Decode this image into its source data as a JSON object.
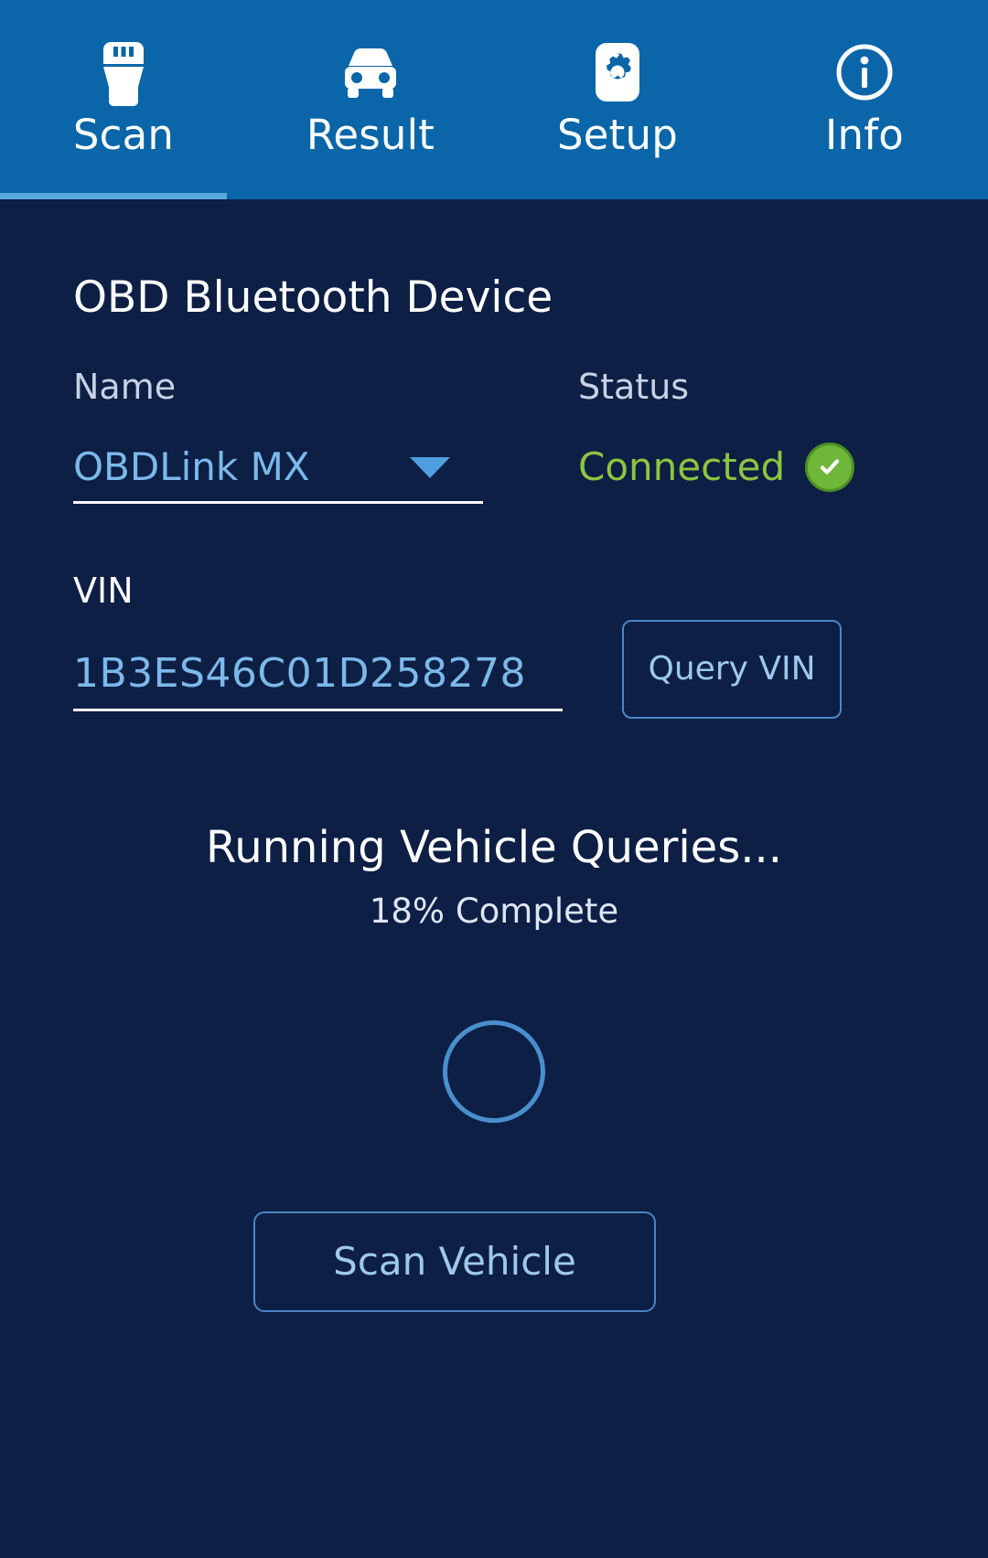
{
  "theme": {
    "tabbar_bg": "#0a66a8",
    "body_bg": "#0d1f45",
    "accent_blue": "#7cb9ea",
    "active_tab_indicator": "#5ba8dc",
    "status_green": "#8cc63f",
    "badge_green": "#6fb739",
    "outline_blue": "#4b86c4"
  },
  "tabs": [
    {
      "label": "Scan",
      "icon": "obd-connector-icon",
      "active": true
    },
    {
      "label": "Result",
      "icon": "car-front-icon",
      "active": false
    },
    {
      "label": "Setup",
      "icon": "gear-icon",
      "active": false
    },
    {
      "label": "Info",
      "icon": "info-circle-icon",
      "active": false
    }
  ],
  "device_section": {
    "title": "OBD Bluetooth Device",
    "name": {
      "label": "Name",
      "value": "OBDLink MX",
      "dropdown_icon": "chevron-down-icon"
    },
    "status": {
      "label": "Status",
      "value": "Connected",
      "badge_icon": "check-circle-icon"
    }
  },
  "vin_section": {
    "label": "VIN",
    "value": "1B3ES46C01D258278",
    "query_button_label": "Query VIN"
  },
  "progress": {
    "title": "Running Vehicle Queries...",
    "percent": 18,
    "subtitle": "18% Complete",
    "spinner_icon": "loading-spinner-icon"
  },
  "actions": {
    "scan_button_label": "Scan Vehicle"
  }
}
